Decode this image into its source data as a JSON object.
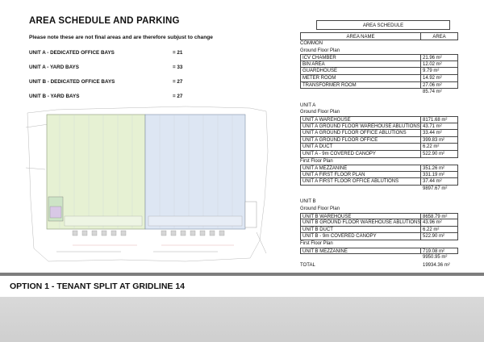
{
  "header": {
    "title": "AREA SCHEDULE AND PARKING",
    "note": "Please note these are not final areas and are therefore subjust to change"
  },
  "parking": [
    {
      "label": "UNIT A - DEDICATED OFFICE BAYS",
      "value": "= 21"
    },
    {
      "label": "UNIT A - YARD BAYS",
      "value": "= 33"
    },
    {
      "label": "UNIT B - DEDICATED OFFICE BAYS",
      "value": "= 27"
    },
    {
      "label": "UNIT B - YARD BAYS",
      "value": "= 27"
    }
  ],
  "schedule": {
    "title": "AREA SCHEDULE",
    "col_name": "AREA NAME",
    "col_area": "AREA",
    "common": {
      "heading": "COMMON",
      "sub": "Ground Floor Plan",
      "rows": [
        {
          "name": "ICV CHAMBER",
          "area": "21.96 m²"
        },
        {
          "name": "BIN AREA",
          "area": "12.02 m²"
        },
        {
          "name": "GUARDHOUSE",
          "area": "9.79 m²"
        },
        {
          "name": "METER ROOM",
          "area": "14.92 m²"
        },
        {
          "name": "TRANSFORMER ROOM",
          "area": "27.06 m²"
        }
      ],
      "total": "85.74 m²"
    },
    "unit_a": {
      "heading": "UNIT A",
      "sub1": "Ground Floor Plan",
      "rows1": [
        {
          "name": "UNIT A WAREHOUSE",
          "area": "8171.68 m²"
        },
        {
          "name": "UNIT A GROUND FLOOR WAREHOUSE ABLUTIONS",
          "area": "43.71 m²"
        },
        {
          "name": "UNIT A GROUND FLOOR OFFICE ABLUTIONS",
          "area": "33.44 m²"
        },
        {
          "name": "UNIT A GROUND FLOOR OFFICE",
          "area": "399.83 m²"
        },
        {
          "name": "UNIT A DUCT",
          "area": "6.22 m²"
        },
        {
          "name": "UNIT A - 9m COVERED CANOPY",
          "area": "522.90 m²"
        }
      ],
      "sub2": "First Floor Plan",
      "rows2": [
        {
          "name": "UNIT A MEZZANINE",
          "area": "351.26 m²"
        },
        {
          "name": "UNIT A FIRST FLOOR PLAN",
          "area": "331.19 m²"
        },
        {
          "name": "UNIT A FIRST FLOOR OFFICE ABLUTIONS",
          "area": "37.44 m²"
        }
      ],
      "total": "9897.67 m²"
    },
    "unit_b": {
      "heading": "UNIT B",
      "sub1": "Ground Floor Plan",
      "rows1": [
        {
          "name": "UNIT B WAREHOUSE",
          "area": "8658.79 m²"
        },
        {
          "name": "UNIT B GROUND FLOOR WAREHOUSE ABLUTIONS",
          "area": "43.96 m²"
        },
        {
          "name": "UNIT B DUCT",
          "area": "6.22 m²"
        },
        {
          "name": "UNIT B - 9m COVERED CANOPY",
          "area": "522.90 m²"
        }
      ],
      "sub2": "First Floor Plan",
      "rows2": [
        {
          "name": "UNIT B MEZZANINE",
          "area": "719.08 m²"
        }
      ],
      "total": "9950.95 m²"
    },
    "grand_label": "TOTAL",
    "grand_total": "19934.36 m²"
  },
  "footer": {
    "title": "OPTION 1 - TENANT SPLIT AT GRIDLINE 14"
  },
  "colors": {
    "unit_a_fill": "#e6f1d3",
    "unit_b_fill": "#dde6f3",
    "footer_band": "#7d7d7d"
  }
}
